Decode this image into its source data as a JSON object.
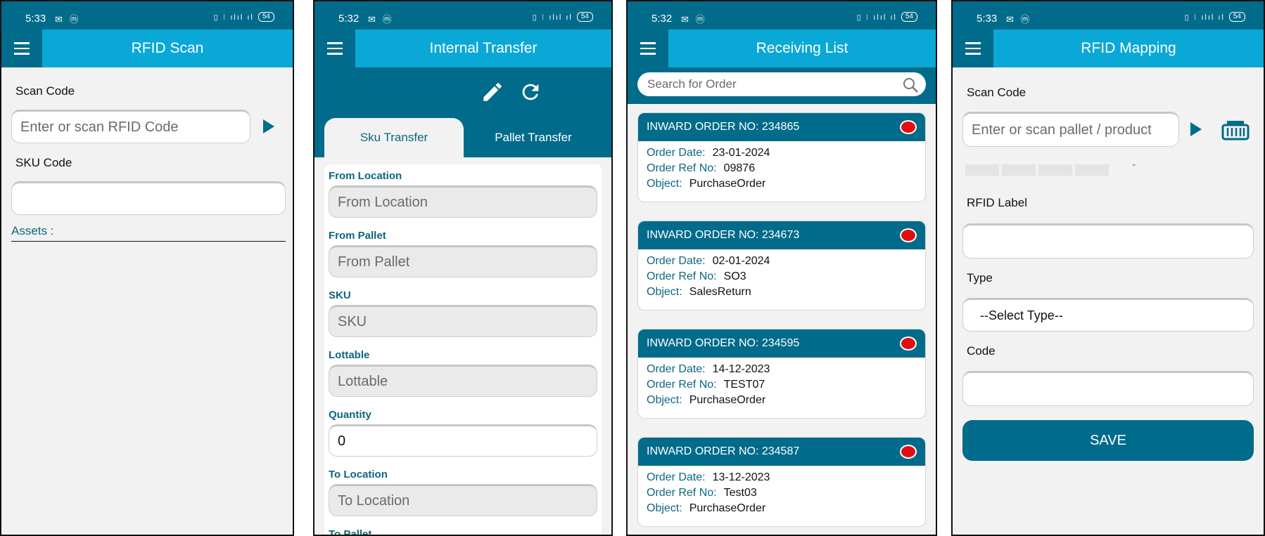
{
  "status_bars": [
    {
      "time": "5:33",
      "battery": "54"
    },
    {
      "time": "5:32",
      "battery": "54"
    },
    {
      "time": "5:32",
      "battery": "54"
    },
    {
      "time": "5:33",
      "battery": "54"
    }
  ],
  "rfid_scan": {
    "title": "RFID Scan",
    "scan_code_label": "Scan Code",
    "scan_code_placeholder": "Enter or scan RFID Code",
    "sku_code_label": "SKU Code",
    "sku_code_value": "",
    "assets_label": "Assets :"
  },
  "internal_transfer": {
    "title": "Internal Transfer",
    "tabs": [
      {
        "label": "Sku Transfer",
        "active": true
      },
      {
        "label": "Pallet Transfer",
        "active": false
      }
    ],
    "fields": [
      {
        "label": "From Location",
        "placeholder": "From Location"
      },
      {
        "label": "From Pallet",
        "placeholder": "From Pallet"
      },
      {
        "label": "SKU",
        "placeholder": "SKU"
      },
      {
        "label": "Lottable",
        "placeholder": "Lottable"
      },
      {
        "label": "Quantity",
        "value": "0"
      },
      {
        "label": "To Location",
        "placeholder": "To Location"
      },
      {
        "label": "To Pallet"
      }
    ]
  },
  "receiving_list": {
    "title": "Receiving List",
    "search_placeholder": "Search for Order",
    "labels": {
      "order_date": "Order Date:",
      "order_ref": "Order Ref No:",
      "object": "Object:"
    },
    "orders": [
      {
        "header": "INWARD ORDER NO: 234865",
        "date": "23-01-2024",
        "ref": "09876",
        "object": "PurchaseOrder"
      },
      {
        "header": "INWARD ORDER NO: 234673",
        "date": "02-01-2024",
        "ref": "SO3",
        "object": "SalesReturn"
      },
      {
        "header": "INWARD ORDER NO: 234595",
        "date": "14-12-2023",
        "ref": "TEST07",
        "object": "PurchaseOrder"
      },
      {
        "header": "INWARD ORDER NO: 234587",
        "date": "13-12-2023",
        "ref": "Test03",
        "object": "PurchaseOrder"
      }
    ],
    "status_color": "#e01010"
  },
  "rfid_mapping": {
    "title": "RFID Mapping",
    "scan_code_label": "Scan Code",
    "scan_code_placeholder": "Enter or scan pallet / product",
    "dash": "-",
    "rfid_label": "RFID Label",
    "type_label": "Type",
    "type_value": "--Select Type--",
    "code_label": "Code",
    "save_label": "SAVE"
  },
  "colors": {
    "primary": "#006b8a",
    "title_bar": "#0aa8d6",
    "label": "#0d6680"
  }
}
